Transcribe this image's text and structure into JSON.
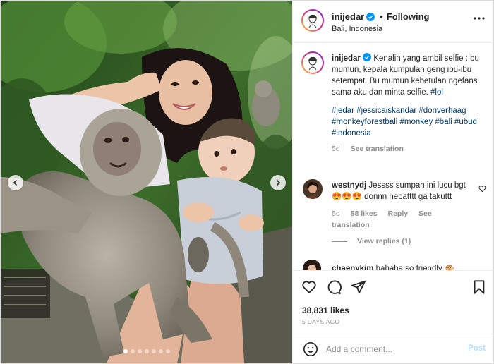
{
  "post": {
    "username": "inijedar",
    "follow_status": "Following",
    "location": "Bali, Indonesia",
    "separator": "•"
  },
  "caption": {
    "username": "inijedar",
    "text": "Kenalin yang ambil selfie : bu mumun, kepala kumpulan geng ibu-ibu setempat. Bu mumun kebetulan ngefans sama aku dan minta selfie.",
    "inline_tag": "#lol",
    "hashtags": [
      "#jedar",
      "#jessicaiskandar",
      "#donverhaag",
      "#monkeyforestbali",
      "#monkey",
      "#bali",
      "#ubud",
      "#indonesia"
    ],
    "age": "5d",
    "see_translation": "See translation"
  },
  "comments": [
    {
      "username": "westnydj",
      "text": "Jessss sumpah ini lucu bgt",
      "emoji": "😍😍😍",
      "text_after": "donnn hebatttt ga takuttt",
      "age": "5d",
      "likes": "58 likes",
      "reply": "Reply",
      "see_translation": "See translation",
      "view_replies": "View replies (1)"
    },
    {
      "username": "chaenykim",
      "text": "hahaha so friendly",
      "emoji": "🐵"
    }
  ],
  "actions": {
    "likes": "38,831 likes",
    "date": "5 DAYS AGO"
  },
  "composer": {
    "placeholder": "Add a comment...",
    "post_label": "Post"
  },
  "carousel": {
    "total": 7,
    "current": 1
  },
  "colors": {
    "link": "#00376b",
    "muted": "#8e8e8e",
    "verified": "#0095f6",
    "post_disabled": "#b2dffc"
  },
  "icons": [
    "verified-badge-icon",
    "more-options-icon",
    "heart-icon",
    "comment-icon",
    "share-icon",
    "bookmark-icon",
    "emoji-icon",
    "chevron-left-icon",
    "chevron-right-icon"
  ]
}
